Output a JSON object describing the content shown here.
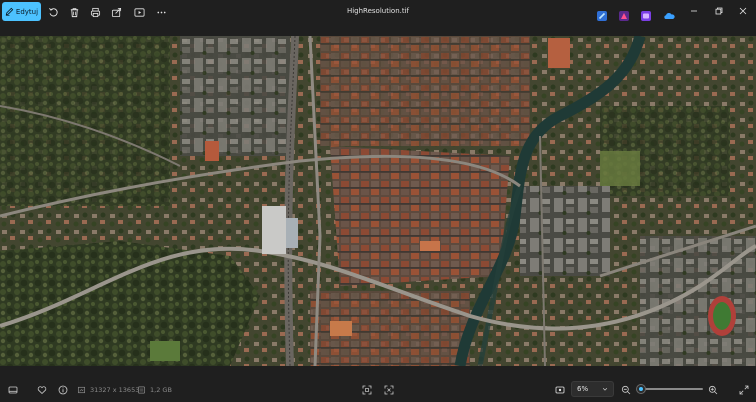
{
  "toolbar": {
    "edit_label": "Edytuj",
    "icons": [
      "rotate-icon",
      "delete-icon",
      "print-icon",
      "share-icon",
      "slideshow-icon",
      "more-icon"
    ]
  },
  "window": {
    "title": "HighResolution.tif",
    "app_icons": [
      {
        "name": "designer-app-icon",
        "color": "#2f8cff"
      },
      {
        "name": "clipchamp-app-icon",
        "color": "#e0356f"
      },
      {
        "name": "photos-app-icon",
        "color": "#b84cf0"
      },
      {
        "name": "onedrive-icon",
        "color": "#3aa0ff"
      }
    ]
  },
  "image": {
    "alt": "aerial satellite photo of a city"
  },
  "statusbar": {
    "dimensions": "31327 x 13653",
    "file_size": "1,2 GB",
    "zoom_value": "6%",
    "zoom_fraction": 0.06
  },
  "colors": {
    "accent": "#4cc2ff",
    "background": "#1c1c1c"
  }
}
